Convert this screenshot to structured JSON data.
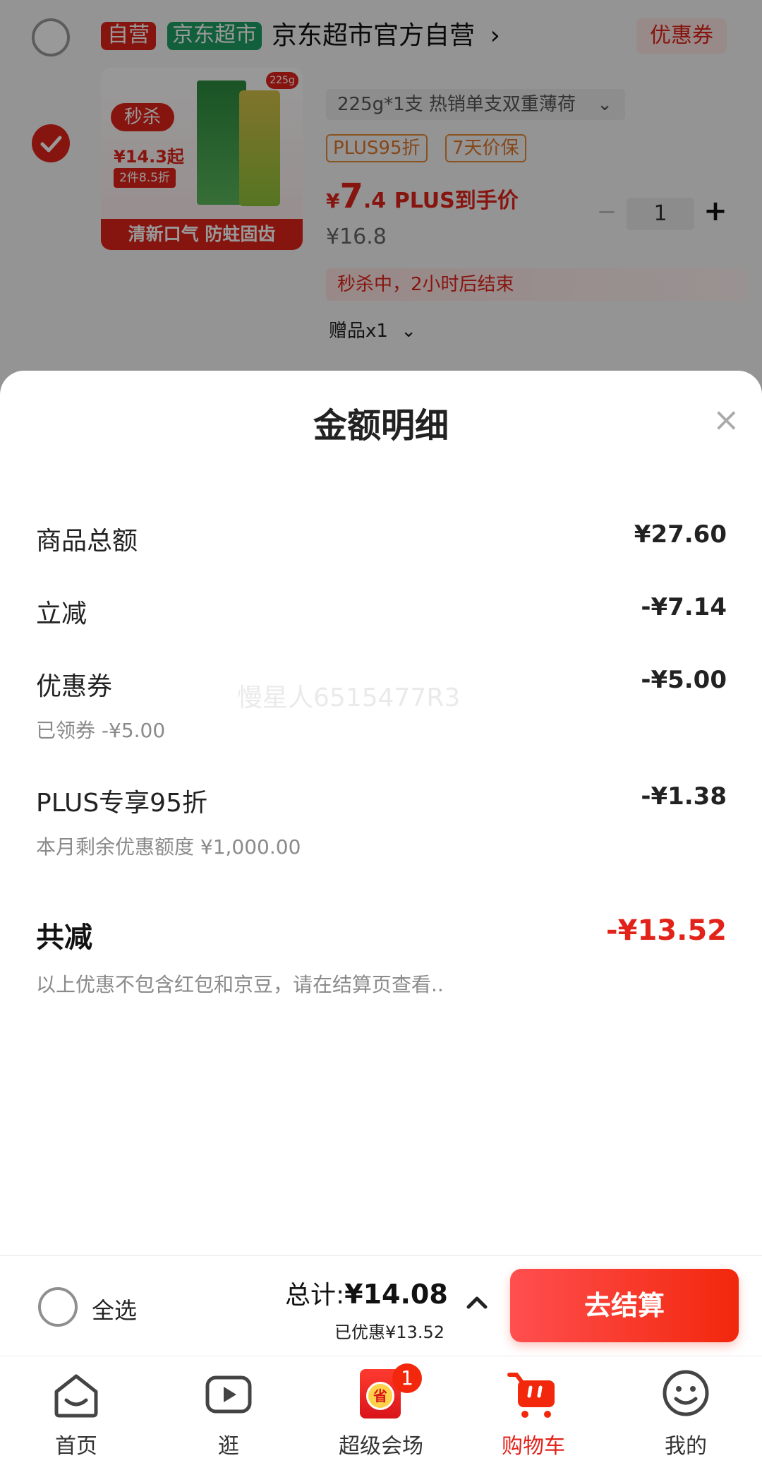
{
  "store": {
    "self_tag": "自营",
    "market_tag": "京东超市",
    "name": "京东超市官方自营",
    "chevron": "›",
    "coupon_button": "优惠券"
  },
  "product": {
    "variant": "225g*1支 热销单支双重薄荷",
    "tag_plus": "PLUS95折",
    "tag_guarantee": "7天价保",
    "price_symbol": "¥",
    "price_int": "7",
    "price_dec": ".4",
    "price_suffix": "PLUS到手价",
    "original_price": "¥16.8",
    "qty_minus": "−",
    "qty": "1",
    "qty_plus": "+",
    "flash_notice": "秒杀中，2小时后结束",
    "gift": "赠品x1",
    "image_badge": "秒杀",
    "image_price": "¥14.3起",
    "image_discount": "2件8.5折",
    "image_weight": "225g",
    "image_slogan": "清新口气 防蛀固齿"
  },
  "sheet": {
    "title": "金额明细",
    "close": "×",
    "rows": [
      {
        "label": "商品总额",
        "value": "¥27.60",
        "sub": ""
      },
      {
        "label": "立减",
        "value": "-¥7.14",
        "sub": ""
      },
      {
        "label": "优惠券",
        "value": "-¥5.00",
        "sub": "已领券 -¥5.00"
      },
      {
        "label": "PLUS专享95折",
        "value": "-¥1.38",
        "sub": "本月剩余优惠额度 ¥1,000.00"
      }
    ],
    "total_label": "共减",
    "total_value": "-¥13.52",
    "note": "以上优惠不包含红包和京豆，请在结算页查看..",
    "watermark": "慢星人6515477R3"
  },
  "bottom": {
    "select_all": "全选",
    "total_label": "总计:",
    "total_value": "¥14.08",
    "saved": "已优惠¥13.52",
    "checkout": "去结算"
  },
  "tabs": [
    {
      "label": "首页",
      "icon": "home-icon"
    },
    {
      "label": "逛",
      "icon": "video-play-icon"
    },
    {
      "label": "超级会场",
      "icon": "super-venue-icon",
      "badge": "1"
    },
    {
      "label": "购物车",
      "icon": "shopping-cart-icon"
    },
    {
      "label": "我的",
      "icon": "smiley-profile-icon"
    }
  ],
  "colors": {
    "accent_red": "#e2231a",
    "checkout_gradient_start": "#ff4f4f",
    "checkout_gradient_end": "#f2270c",
    "green_tag": "#1e9e63",
    "plus_orange": "#e0772b"
  }
}
